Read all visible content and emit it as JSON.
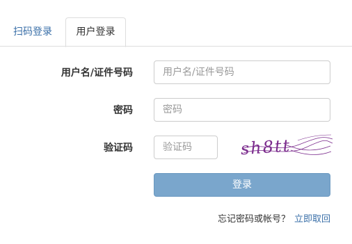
{
  "tabs": {
    "qr_label": "扫码登录",
    "password_label": "用户登录"
  },
  "form": {
    "username_label": "用户名/证件号码",
    "username_placeholder": "用户名/证件号码",
    "password_label": "密码",
    "password_placeholder": "密码",
    "captcha_label": "验证码",
    "captcha_placeholder": "验证码",
    "captcha_text": "sh8tt",
    "login_button": "登录"
  },
  "footer": {
    "forgot_text": "忘记密码或帐号？",
    "recover_link": "立即取回"
  },
  "colors": {
    "accent": "#3a6fa8",
    "button": "#7aa6cc",
    "captcha_ink": "#7a2a8c"
  }
}
